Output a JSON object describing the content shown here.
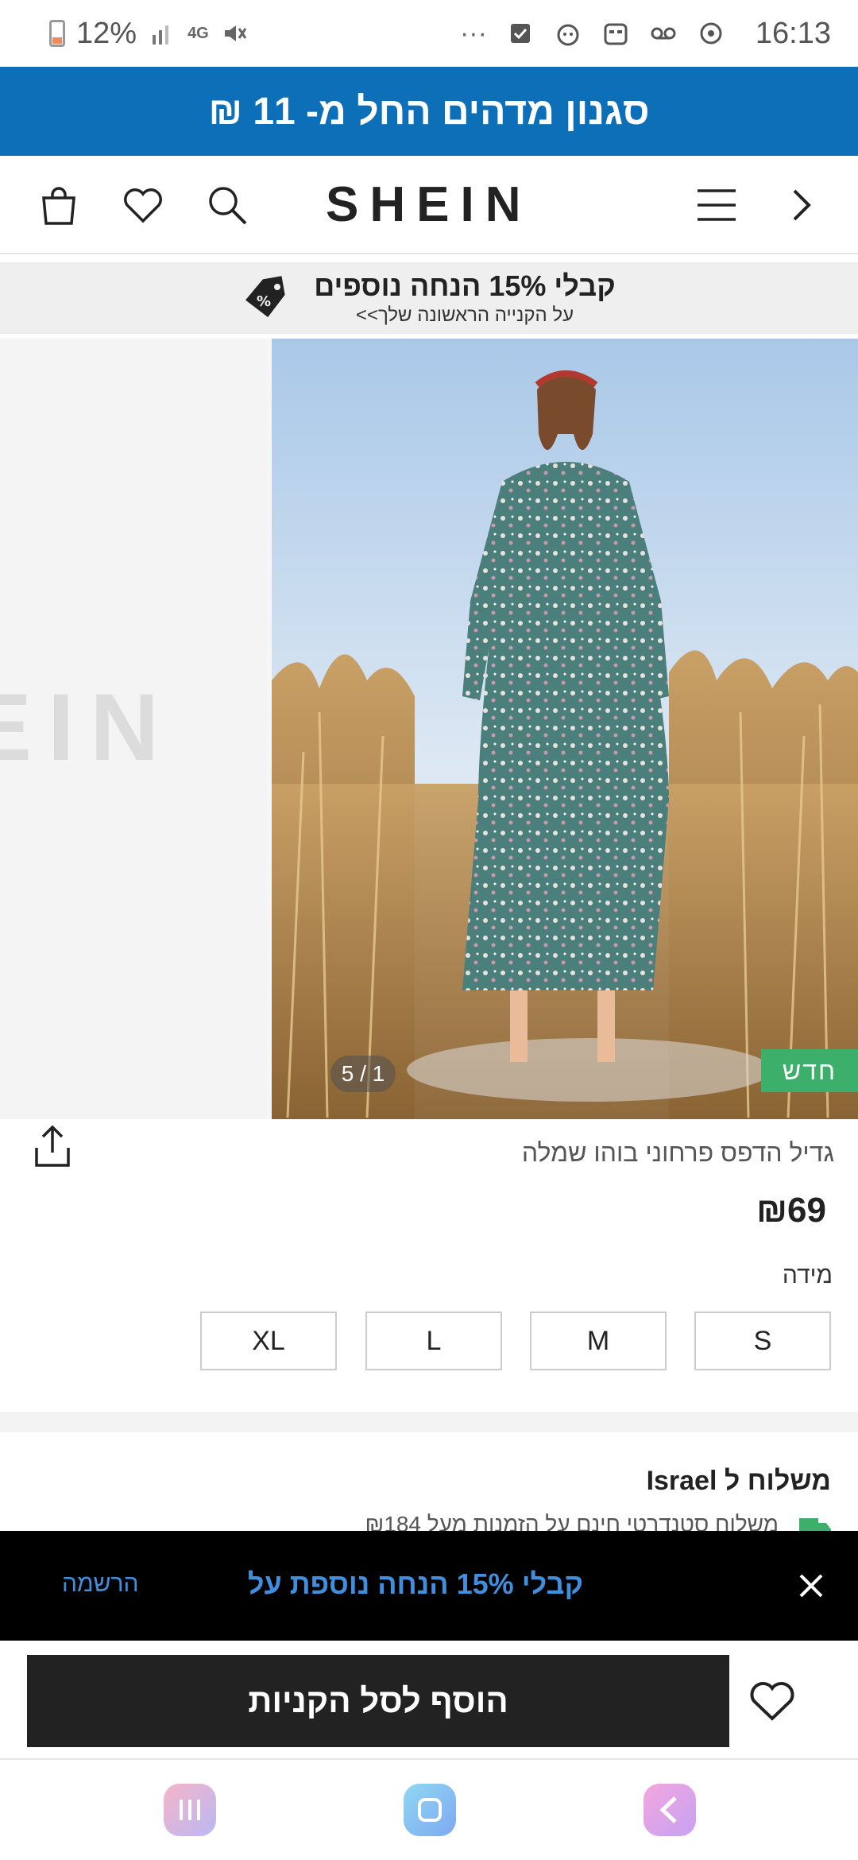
{
  "status_bar": {
    "battery_text": "12%",
    "network": "4G",
    "time": "16:13",
    "icons": [
      "battery-icon",
      "signal-icon",
      "data-4g-icon",
      "mute-icon",
      "more-dots-icon",
      "checkbox-icon",
      "app-icon",
      "emoji-icon",
      "voicemail-icon",
      "sync-icon"
    ]
  },
  "promo_banner": {
    "text": "סגנון מדהים החל מ- 11 ₪",
    "color": "#0d6fb8"
  },
  "header": {
    "logo": "SHEIN",
    "icons": [
      "cart-icon",
      "heart-icon",
      "search-icon",
      "menu-icon",
      "chevron-right-icon"
    ]
  },
  "discount_strip": {
    "main": "קבלי 15% הנחה נוספים",
    "sub": "על הקנייה הראשונה שלך>>",
    "icon": "discount-tag-icon"
  },
  "gallery": {
    "watermark": "EIN",
    "badge": "חדש",
    "counter": "5 / 1",
    "badge_color": "#3cb06a"
  },
  "product": {
    "title": "גדיל הדפס פרחוני בוהו שמלה",
    "price": "₪69",
    "size_label": "מידה",
    "sizes": [
      "S",
      "M",
      "L",
      "XL"
    ]
  },
  "shipping": {
    "title": "משלוח ל Israel",
    "subtitle": "משלוח סטנדרטי חינם על הזמנות מעל ₪184"
  },
  "signup_bar": {
    "text": "קבלי 15% הנחה נוספת על",
    "link": "הרשמה",
    "accent": "#3f8fde"
  },
  "actions": {
    "add_to_cart": "הוסף לסל הקניות"
  },
  "nav": {
    "icons": [
      "recent-apps-icon",
      "home-icon",
      "back-icon"
    ]
  }
}
